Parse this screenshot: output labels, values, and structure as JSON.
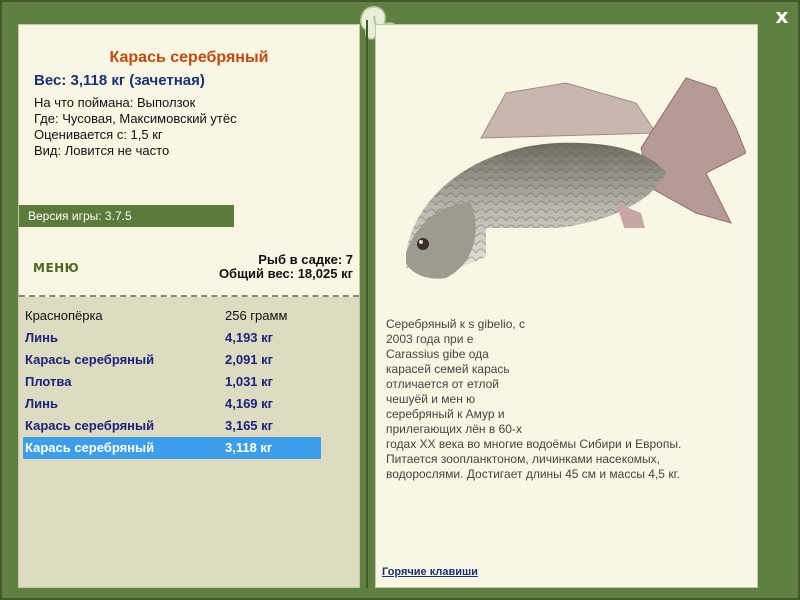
{
  "window": {
    "close_label": "x"
  },
  "fish": {
    "title": "Карась серебряный",
    "weight_line": "Вес: 3,118 кг (зачетная)",
    "info": [
      "На что поймана: Выползок",
      "Где: Чусовая, Максимовский утёс",
      "Оценивается с: 1,5 кг",
      "Вид: Ловится не часто"
    ]
  },
  "version": "Версия игры: 3.7.5",
  "menu_label": "МЕНЮ",
  "cage": {
    "count_line": "Рыб в садке: 7",
    "total_line": "Общий вес: 18,025 кг"
  },
  "catch_list": [
    {
      "name": "Краснопёрка",
      "weight": "256 грамм",
      "style": "plain"
    },
    {
      "name": "Линь",
      "weight": "4,193 кг",
      "style": "bold"
    },
    {
      "name": "Карась серебряный",
      "weight": "2,091 кг",
      "style": "bold"
    },
    {
      "name": "Плотва",
      "weight": "1,031 кг",
      "style": "bold"
    },
    {
      "name": "Линь",
      "weight": "4,169 кг",
      "style": "bold"
    },
    {
      "name": "Карась серебряный",
      "weight": "3,165 кг",
      "style": "bold"
    },
    {
      "name": "Карась серебряный",
      "weight": "3,118 кг",
      "style": "selected"
    }
  ],
  "description": [
    "Серебряный к                                        s gibelio, с",
    "2003 года при                                          е",
    "Carassius gibe                                       ода",
    "карасей семей                                      карась",
    "отличается от                                       етлой",
    "чешуёй и мен                                          ю",
    "серебряный к                                     Амур и",
    "прилегающих                                      лён в 60-х",
    "годах XX века во многие водоёмы Сибири и Европы.",
    "Питается зоопланктоном, личинками насекомых,",
    "водорослями. Достигает длины 45 см и массы 4,5 кг."
  ],
  "hotkeys_label": "Горячие клавиши",
  "icons": {
    "close": "close-icon",
    "ornament": "leaf-ornament-icon",
    "fish": "crucian-carp-image"
  },
  "colors": {
    "frame": "#5f8040",
    "title": "#c24a10",
    "link": "#18327a",
    "selected": "#3d9eec"
  }
}
